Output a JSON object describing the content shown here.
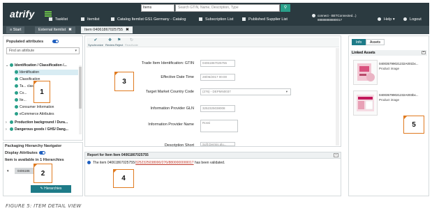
{
  "app": {
    "logo_text": "atrify"
  },
  "top_search": {
    "scope_value": "Items",
    "placeholder": "Search GTIN, Name, Description, Type"
  },
  "nav": {
    "tasklist": "Tasklist",
    "itemlist": "Itemlist",
    "catalog": "Catalog Itemlist GS1 Germany - Catalog",
    "subscription": "Subscription List",
    "published": "Published Supplier List",
    "user_line1": "connect - BETConnected...)",
    "user_line2": "88888888880017",
    "help": "Help",
    "logout": "Logout"
  },
  "tabs": [
    {
      "label": "Start"
    },
    {
      "label": "External Itemlist"
    },
    {
      "label": "Item 04061867025755"
    }
  ],
  "left_panel": {
    "populated_label": "Populated attributes",
    "find_placeholder": "Find an attribute",
    "tree": [
      {
        "label": "Identification / Classification /..."
      },
      {
        "label": "Identification"
      },
      {
        "label": "Classification"
      },
      {
        "label": "Ta... classification"
      },
      {
        "label": "Co..."
      },
      {
        "label": "Ite..."
      },
      {
        "label": "Consumer Information"
      },
      {
        "label": "eCommerce Attributes"
      },
      {
        "label": "Production background / Dura..."
      },
      {
        "label": "Dangerous goods / GHS/ Dang..."
      }
    ]
  },
  "pack_panel": {
    "title": "Packaging Hierarchy Navigator",
    "display_attributes": "Display Attributes",
    "available": "Item is available in 1 Hierarchies",
    "gtin_prefix": "0406186",
    "gtin_suffix": "5455",
    "hierarchies_button": "Hierarchies"
  },
  "toolbar": {
    "synchronize": "Synchronize",
    "review": "Review",
    "reject": "Reject",
    "reactivate": "Reactivate"
  },
  "form": {
    "fields": [
      {
        "label": "Trade Item Identification: GTIN",
        "value": "04061867025755"
      },
      {
        "label": "Effective Date Time",
        "value": "28/06/2017 00:00"
      },
      {
        "label": "Target Market Country Code",
        "value": "(276) - DEPMN0037"
      },
      {
        "label": "Information Provider GLN",
        "value": "3252325038008"
      },
      {
        "label": "Information Provider Name",
        "value": "Rossi"
      },
      {
        "label": "Description Short",
        "value": "Soft Dermis plu..."
      }
    ]
  },
  "report": {
    "title": "Report for Item Item 04061867025755",
    "line_before": "The item 04061867025755/",
    "line_highlight": "3252325038000/276/8800000000017",
    "line_after": " has been validated."
  },
  "right_panel": {
    "tab_info": "Info",
    "tab_assets": "Assets",
    "linked_assets": "Linked Assets",
    "assets": [
      {
        "name": "040035799021232A001bx...",
        "type": "Product image"
      },
      {
        "name": "040035799021232A003bx...",
        "type": "Product image"
      }
    ]
  },
  "callouts": [
    "1",
    "2",
    "3",
    "4",
    "5"
  ],
  "caption": "FIGURE 5: ITEM DETAIL VIEW",
  "colors": {
    "topbar": "#2b3a40",
    "accent_teal": "#1e7b88",
    "callout_orange": "#e07a1f",
    "check_green": "#2aa08a"
  }
}
